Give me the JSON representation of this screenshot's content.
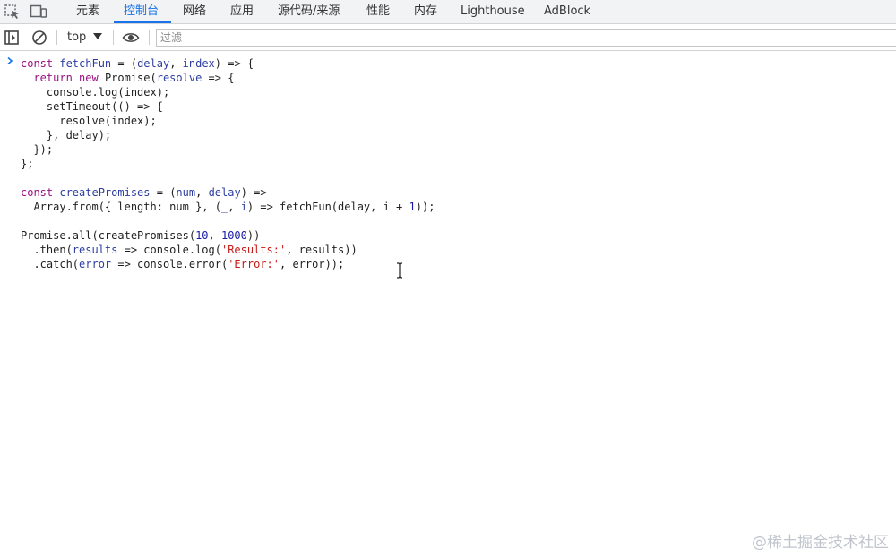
{
  "tabs": [
    {
      "label": "元素"
    },
    {
      "label": "控制台"
    },
    {
      "label": "网络"
    },
    {
      "label": "应用"
    },
    {
      "label": "源代码/来源"
    },
    {
      "label": "性能"
    },
    {
      "label": "内存"
    },
    {
      "label": "Lighthouse"
    },
    {
      "label": "AdBlock"
    }
  ],
  "active_tab": "控制台",
  "toolbar": {
    "context": "top",
    "filter_placeholder": "过滤"
  },
  "code": {
    "l1": {
      "a": "const ",
      "b": "fetchFun",
      "c": " = (",
      "d": "delay",
      "e": ", ",
      "f": "index",
      "g": ") => {"
    },
    "l2": {
      "a": "  return ",
      "b": "new ",
      "c": "Promise(",
      "d": "resolve",
      "e": " => {"
    },
    "l3": {
      "a": "    console.log(index);"
    },
    "l4": {
      "a": "    setTimeout(() => {"
    },
    "l5": {
      "a": "      resolve(index);"
    },
    "l6": {
      "a": "    }, delay);"
    },
    "l7": {
      "a": "  });"
    },
    "l8": {
      "a": "};"
    },
    "l9": {
      "a": "const ",
      "b": "createPromises",
      "c": " = (",
      "d": "num",
      "e": ", ",
      "f": "delay",
      "g": ") =>"
    },
    "l10": {
      "a": "  Array.from({ length: num }, (",
      "b": "_",
      "c": ", ",
      "d": "i",
      "e": ") => fetchFun(delay, i + ",
      "f": "1",
      "g": "));"
    },
    "l11": {
      "a": "Promise.all(createPromises(",
      "b": "10",
      "c": ", ",
      "d": "1000",
      "e": "))"
    },
    "l12": {
      "a": "  .then(",
      "b": "results",
      "c": " => console.log(",
      "d": "'Results:'",
      "e": ", results))"
    },
    "l13": {
      "a": "  .catch(",
      "b": "error",
      "c": " => console.error(",
      "d": "'Error:'",
      "e": ", error));"
    }
  },
  "watermark": "@稀土掘金技术社区",
  "colors": {
    "accent": "#1a73e8",
    "keyword": "#9a0f7f",
    "variable": "#2d3ea0",
    "number": "#1a1aa6",
    "string": "#c41a16"
  },
  "icons": {
    "inspect": "inspect-element-icon",
    "device": "device-toolbar-icon",
    "sidebar": "show-sidebar-icon",
    "clear": "clear-console-icon",
    "eye": "live-expression-icon",
    "prompt": "chevron-right-icon",
    "cursor": "text-cursor-icon"
  }
}
